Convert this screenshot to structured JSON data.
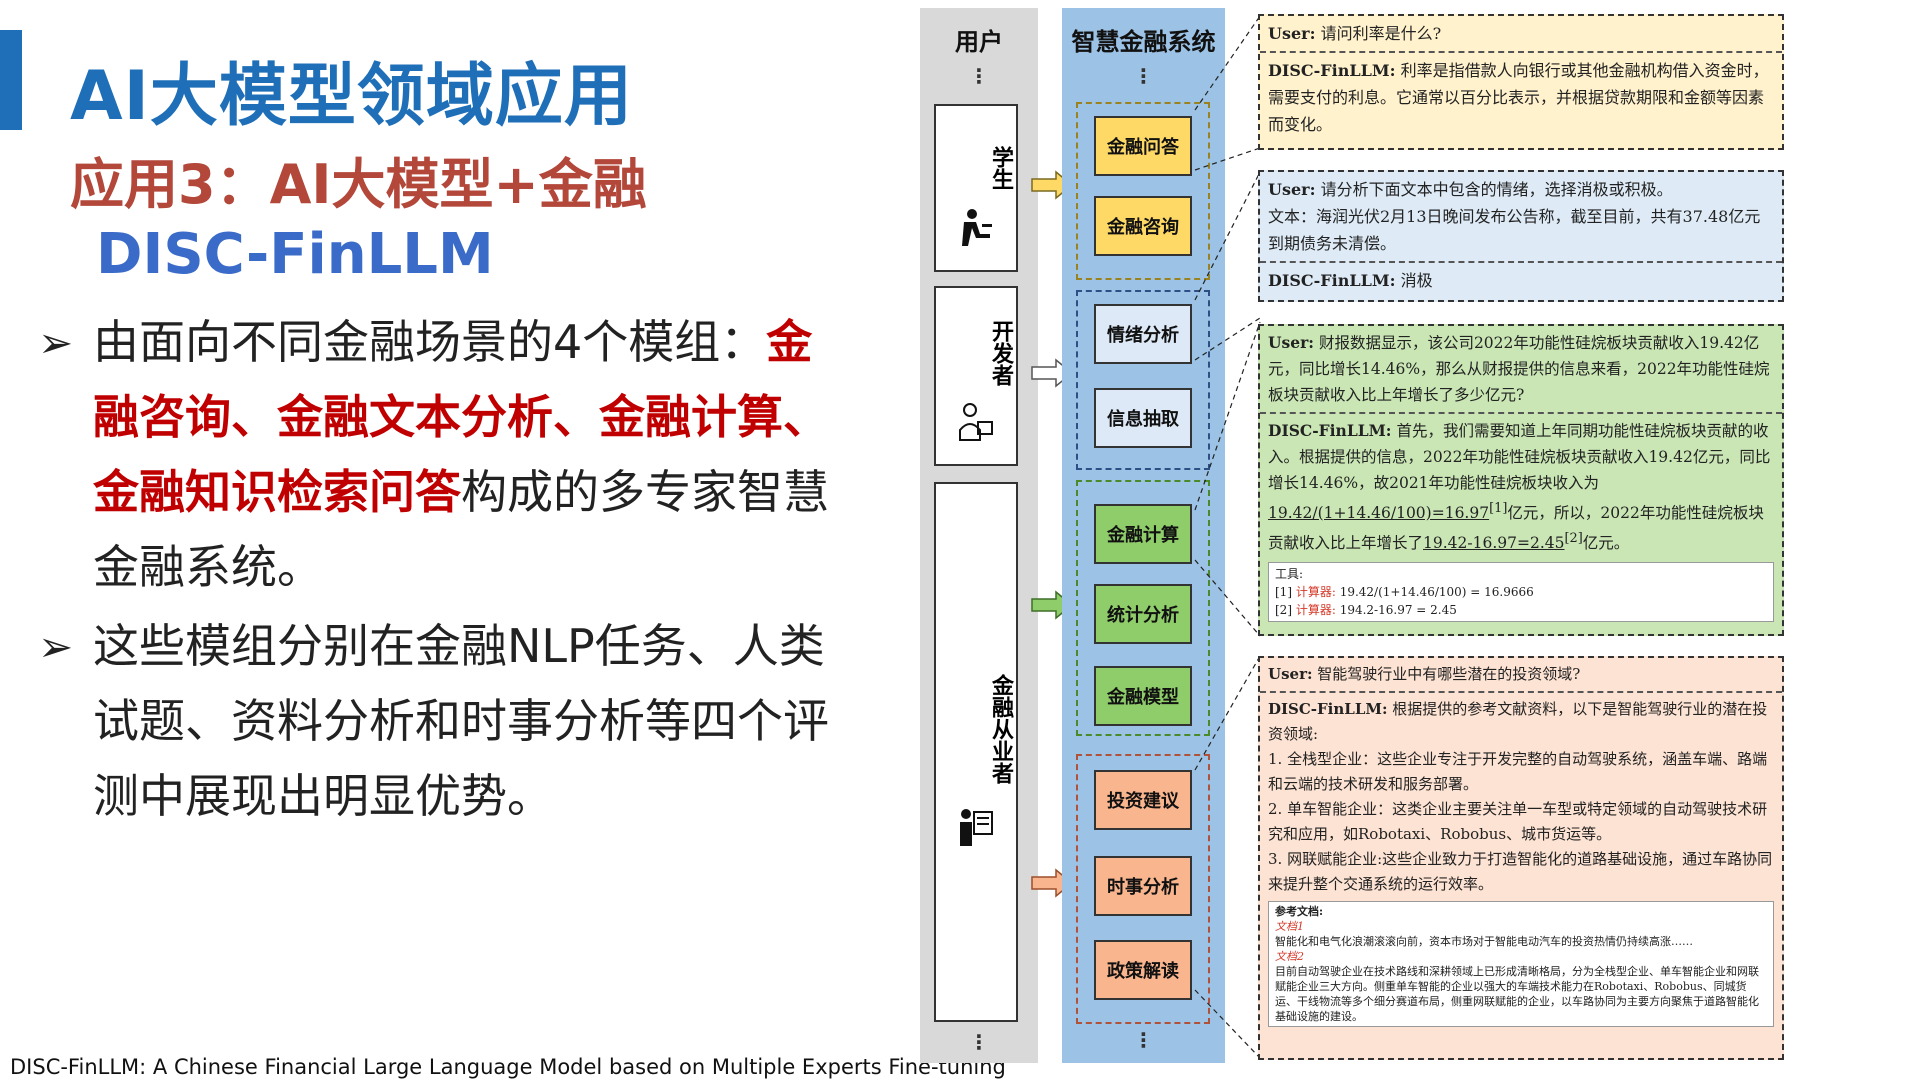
{
  "slide": {
    "title": "AI大模型领域应用",
    "subtitle": "应用3：AI大模型+金融",
    "model_name": "DISC-FinLLM",
    "bullets": [
      {
        "parts": [
          {
            "text": "由面向不同金融场景的4个模组：",
            "emphasis": false
          },
          {
            "text": "金融咨询、金融文本分析、金融计算、金融知识检索问答",
            "emphasis": true
          },
          {
            "text": "构成的多专家智慧金融系统。",
            "emphasis": false
          }
        ]
      },
      {
        "parts": [
          {
            "text": "这些模组分别在金融NLP任务、人类试题、资料分析和时事分析等四个评测中展现出明显优势。",
            "emphasis": false
          }
        ]
      }
    ],
    "footnote": "DISC-FinLLM: A Chinese Financial Large Language Model based on Multiple Experts Fine-tuning"
  },
  "figure": {
    "user_column_title": "用户",
    "system_column_title": "智慧金融系统",
    "ellipsis": "⋮",
    "users": [
      {
        "label": "学生",
        "icon": "student-icon"
      },
      {
        "label": "开发者",
        "icon": "developer-icon"
      },
      {
        "label": "金融从业者",
        "icon": "professional-icon"
      }
    ],
    "modules": [
      {
        "label": "金融问答",
        "color": "#ffd966"
      },
      {
        "label": "金融咨询",
        "color": "#ffd966"
      },
      {
        "label": "情绪分析",
        "color": "#dde9f7"
      },
      {
        "label": "信息抽取",
        "color": "#dde9f7"
      },
      {
        "label": "金融计算",
        "color": "#8fcc6a"
      },
      {
        "label": "统计分析",
        "color": "#8fcc6a"
      },
      {
        "label": "金融模型",
        "color": "#8fcc6a"
      },
      {
        "label": "投资建议",
        "color": "#f8b58e"
      },
      {
        "label": "时事分析",
        "color": "#f8b58e"
      },
      {
        "label": "政策解读",
        "color": "#f8b58e"
      }
    ],
    "group_border_colors": [
      "#9a8220",
      "#2d4f85",
      "#4a8a2a",
      "#b0523a"
    ],
    "arrow_colors": [
      "#ffd966",
      "#ffffff",
      "#8fcc6a",
      "#f8b58e"
    ],
    "panels": [
      {
        "bg": "#fff2cc",
        "user_label": "User:",
        "user_text": "请问利率是什么?",
        "bot_label": "DISC-FinLLM:",
        "bot_text": "利率是指借款人向银行或其他金融机构借入资金时，需要支付的利息。它通常以百分比表示，并根据贷款期限和金额等因素而变化。"
      },
      {
        "bg": "#deebf7",
        "user_label": "User:",
        "user_text": "请分析下面文本中包含的情绪，选择消极或积极。",
        "extra_text": "文本：海润光伏2月13日晚间发布公告称，截至目前，共有37.48亿元到期债务未清偿。",
        "bot_label": "DISC-FinLLM:",
        "bot_text": "消极"
      },
      {
        "bg": "#c9e6b4",
        "user_label": "User:",
        "user_text": "财报数据显示，该公司2022年功能性硅烷板块贡献收入19.42亿元，同比增长14.46%，那么从财报提供的信息来看，2022年功能性硅烷板块贡献收入比上年增长了多少亿元?",
        "bot_label": "DISC-FinLLM:",
        "bot_text_1": "首先，我们需要知道上年同期功能性硅烷板块贡献的收入。根据提供的信息，2022年功能性硅烷板块贡献收入19.42亿元，同比增长14.46%，故2021年功能性硅烷板块收入为",
        "bot_formula_1": "19.42/(1+14.46/100)=16.97",
        "bot_ref_1": "[1]",
        "bot_text_2": "亿元，所以，2022年功能性硅烷板块贡献收入比上年增长了",
        "bot_formula_2": "19.42-16.97=2.45",
        "bot_ref_2": "[2]",
        "bot_text_3": "亿元。",
        "tools_title": "工具:",
        "tools": [
          {
            "id": "[1]",
            "name": "计算器:",
            "expr": "19.42/(1+14.46/100) = 16.9666"
          },
          {
            "id": "[2]",
            "name": "计算器:",
            "expr": "194.2-16.97 = 2.45"
          }
        ]
      },
      {
        "bg": "#fde3d3",
        "user_label": "User:",
        "user_text": "智能驾驶行业中有哪些潜在的投资领域?",
        "bot_label": "DISC-FinLLM:",
        "bot_text": "根据提供的参考文献资料，以下是智能驾驶行业的潜在投资领域:",
        "items": [
          "1. 全栈型企业：这些企业专注于开发完整的自动驾驶系统，涵盖车端、路端和云端的技术研发和服务部署。",
          "2. 单车智能企业：这类企业主要关注单一车型或特定领域的自动驾驶技术研究和应用，如Robotaxi、Robobus、城市货运等。",
          "3. 网联赋能企业:这些企业致力于打造智能化的道路基础设施，通过车路协同来提升整个交通系统的运行效率。"
        ],
        "refs_title": "参考文档:",
        "refs": [
          {
            "name": "文档1",
            "text": "智能化和电气化浪潮滚滚向前，资本市场对于智能电动汽车的投资热情仍持续高涨……"
          },
          {
            "name": "文档2",
            "text": "目前自动驾驶企业在技术路线和深耕领域上已形成清晰格局，分为全栈型企业、单车智能企业和网联赋能企业三大方向。侧重单车智能的企业以强大的车端技术能力在Robotaxi、Robobus、同城货运、干线物流等多个细分赛道布局，侧重网联赋能的企业，以车路协同为主要方向聚焦于道路智能化基础设施的建设。"
          }
        ]
      }
    ]
  }
}
